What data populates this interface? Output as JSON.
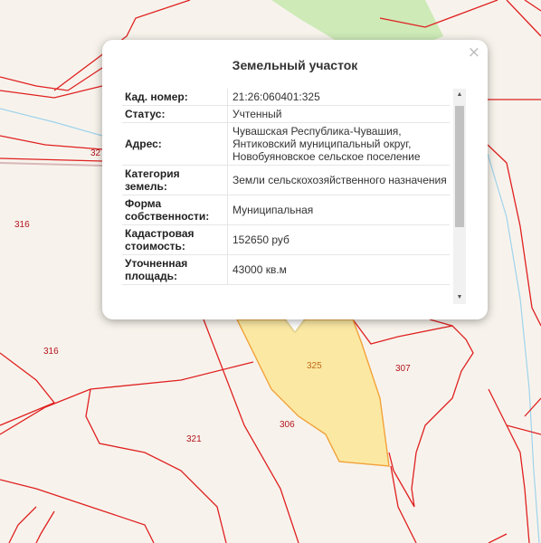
{
  "map": {
    "plot_labels": [
      "32",
      "316",
      "316",
      "321",
      "306",
      "307"
    ],
    "selected_label": "325",
    "colors": {
      "boundary": "#e02020",
      "selected_fill": "#fbe9a3",
      "selected_stroke": "#f2a23a",
      "green_area": "#cdeab7",
      "water": "#9fd3ec"
    }
  },
  "popup": {
    "title": "Земельный участок",
    "close_icon": "×",
    "rows": [
      {
        "key": "Кад. номер:",
        "value": "21:26:060401:325"
      },
      {
        "key": "Статус:",
        "value": "Учтенный"
      },
      {
        "key": "Адрес:",
        "value": "Чувашская Республика-Чувашия, Янтиковский муниципальный округ, Новобуяновское сельское поселение"
      },
      {
        "key": "Категория земель:",
        "value": "Земли сельскохозяйственного назначения"
      },
      {
        "key": "Форма собственности:",
        "value": "Муниципальная"
      },
      {
        "key": "Кадастровая стоимость:",
        "value": "152650 руб"
      },
      {
        "key": "Уточненная площадь:",
        "value": "43000 кв.м"
      }
    ]
  }
}
